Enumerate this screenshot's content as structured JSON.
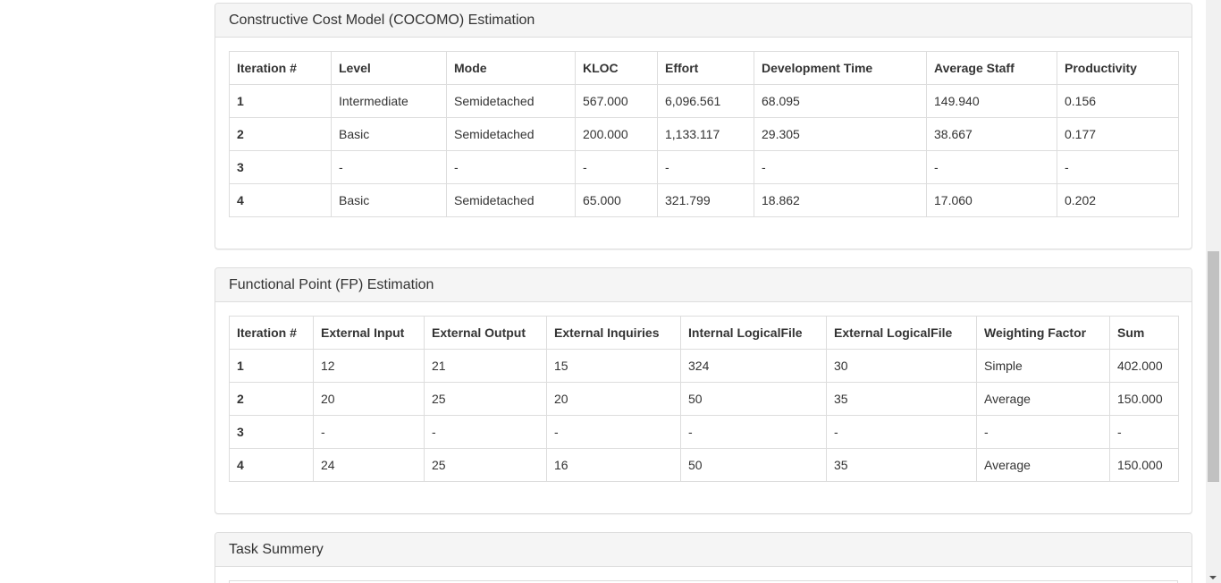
{
  "cocomo": {
    "title": "Constructive Cost Model (COCOMO) Estimation",
    "headers": [
      "Iteration #",
      "Level",
      "Mode",
      "KLOC",
      "Effort",
      "Development Time",
      "Average Staff",
      "Productivity"
    ],
    "rows": [
      [
        "1",
        "Intermediate",
        "Semidetached",
        "567.000",
        "6,096.561",
        "68.095",
        "149.940",
        "0.156"
      ],
      [
        "2",
        "Basic",
        "Semidetached",
        "200.000",
        "1,133.117",
        "29.305",
        "38.667",
        "0.177"
      ],
      [
        "3",
        "-",
        "-",
        "-",
        "-",
        "-",
        "-",
        "-"
      ],
      [
        "4",
        "Basic",
        "Semidetached",
        "65.000",
        "321.799",
        "18.862",
        "17.060",
        "0.202"
      ]
    ]
  },
  "fp": {
    "title": "Functional Point (FP) Estimation",
    "headers": [
      "Iteration #",
      "External Input",
      "External Output",
      "External Inquiries",
      "Internal LogicalFile",
      "External LogicalFile",
      "Weighting Factor",
      "Sum"
    ],
    "rows": [
      [
        "1",
        "12",
        "21",
        "15",
        "324",
        "30",
        "Simple",
        "402.000"
      ],
      [
        "2",
        "20",
        "25",
        "20",
        "50",
        "35",
        "Average",
        "150.000"
      ],
      [
        "3",
        "-",
        "-",
        "-",
        "-",
        "-",
        "-",
        "-"
      ],
      [
        "4",
        "24",
        "25",
        "16",
        "50",
        "35",
        "Average",
        "150.000"
      ]
    ]
  },
  "task_summary": {
    "title": "Task Summery"
  }
}
